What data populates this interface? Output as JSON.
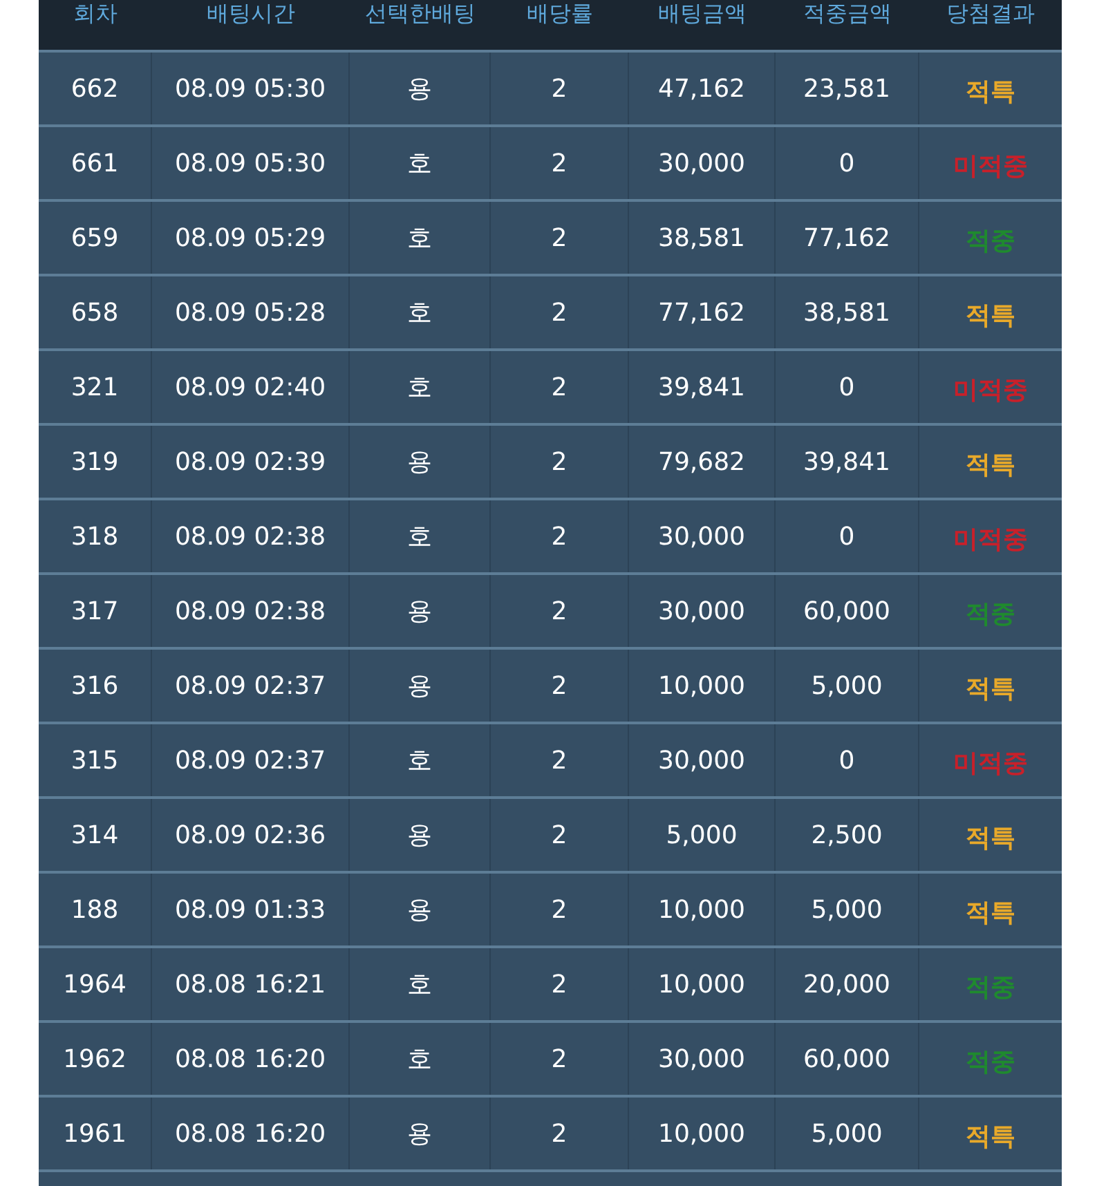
{
  "columns": [
    "회차",
    "배팅시간",
    "선택한배팅",
    "배당률",
    "배팅금액",
    "적중금액",
    "당첨결과"
  ],
  "rows": [
    {
      "round": "662",
      "time": "08.09 05:30",
      "pick": "용",
      "odds": "2",
      "bet": "47,162",
      "win": "23,581",
      "result": "적특",
      "color": "#e8a92a"
    },
    {
      "round": "661",
      "time": "08.09 05:30",
      "pick": "호",
      "odds": "2",
      "bet": "30,000",
      "win": "0",
      "result": "미적중",
      "color": "#c8202a"
    },
    {
      "round": "659",
      "time": "08.09 05:29",
      "pick": "호",
      "odds": "2",
      "bet": "38,581",
      "win": "77,162",
      "result": "적중",
      "color": "#1f8a2e"
    },
    {
      "round": "658",
      "time": "08.09 05:28",
      "pick": "호",
      "odds": "2",
      "bet": "77,162",
      "win": "38,581",
      "result": "적특",
      "color": "#e8a92a"
    },
    {
      "round": "321",
      "time": "08.09 02:40",
      "pick": "호",
      "odds": "2",
      "bet": "39,841",
      "win": "0",
      "result": "미적중",
      "color": "#c8202a"
    },
    {
      "round": "319",
      "time": "08.09 02:39",
      "pick": "용",
      "odds": "2",
      "bet": "79,682",
      "win": "39,841",
      "result": "적특",
      "color": "#e8a92a"
    },
    {
      "round": "318",
      "time": "08.09 02:38",
      "pick": "호",
      "odds": "2",
      "bet": "30,000",
      "win": "0",
      "result": "미적중",
      "color": "#c8202a"
    },
    {
      "round": "317",
      "time": "08.09 02:38",
      "pick": "용",
      "odds": "2",
      "bet": "30,000",
      "win": "60,000",
      "result": "적중",
      "color": "#1f8a2e"
    },
    {
      "round": "316",
      "time": "08.09 02:37",
      "pick": "용",
      "odds": "2",
      "bet": "10,000",
      "win": "5,000",
      "result": "적특",
      "color": "#e8a92a"
    },
    {
      "round": "315",
      "time": "08.09 02:37",
      "pick": "호",
      "odds": "2",
      "bet": "30,000",
      "win": "0",
      "result": "미적중",
      "color": "#c8202a"
    },
    {
      "round": "314",
      "time": "08.09 02:36",
      "pick": "용",
      "odds": "2",
      "bet": "5,000",
      "win": "2,500",
      "result": "적특",
      "color": "#e8a92a"
    },
    {
      "round": "188",
      "time": "08.09 01:33",
      "pick": "용",
      "odds": "2",
      "bet": "10,000",
      "win": "5,000",
      "result": "적특",
      "color": "#e8a92a"
    },
    {
      "round": "1964",
      "time": "08.08 16:21",
      "pick": "호",
      "odds": "2",
      "bet": "10,000",
      "win": "20,000",
      "result": "적중",
      "color": "#1f8a2e"
    },
    {
      "round": "1962",
      "time": "08.08 16:20",
      "pick": "호",
      "odds": "2",
      "bet": "30,000",
      "win": "60,000",
      "result": "적중",
      "color": "#1f8a2e"
    },
    {
      "round": "1961",
      "time": "08.08 16:20",
      "pick": "용",
      "odds": "2",
      "bet": "10,000",
      "win": "5,000",
      "result": "적특",
      "color": "#e8a92a"
    }
  ]
}
